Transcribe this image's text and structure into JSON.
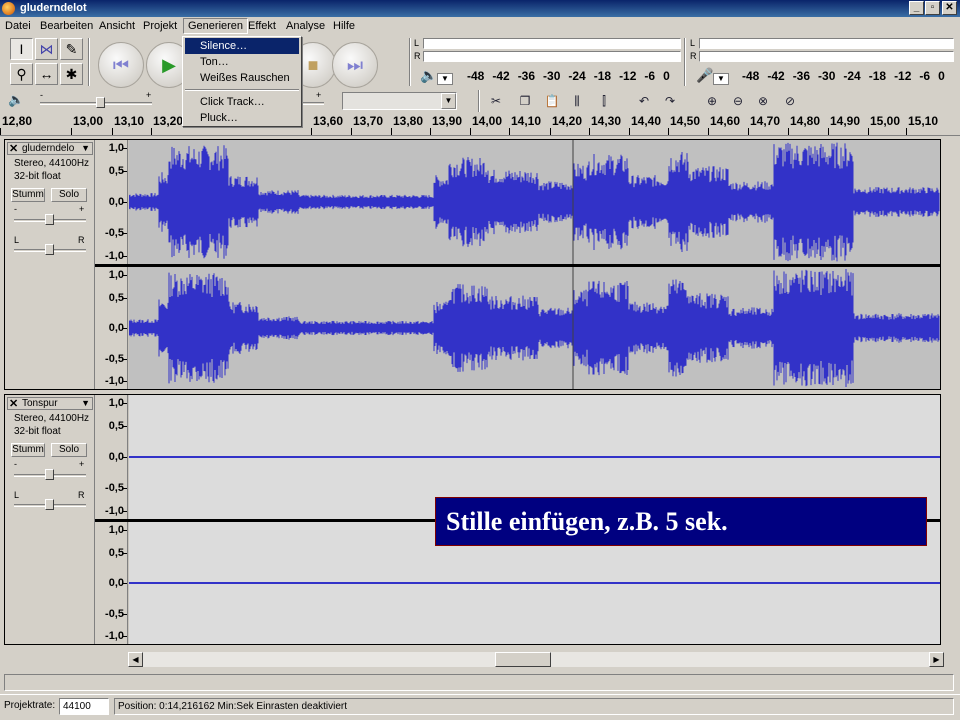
{
  "window": {
    "title": "gluderndelot",
    "buttons": [
      "_",
      "▫",
      "✕"
    ]
  },
  "menubar": {
    "items": [
      "Datei",
      "Bearbeiten",
      "Ansicht",
      "Projekt",
      "Generieren",
      "Effekt",
      "Analyse",
      "Hilfe"
    ],
    "open_menu": "Generieren"
  },
  "generate_menu": {
    "items": [
      "Silence…",
      "Ton…",
      "Weißes Rauschen",
      "Click Track…",
      "Pluck…"
    ],
    "highlighted": "Silence…"
  },
  "meters": {
    "output_L": "L",
    "output_R": "R",
    "input_L": "L",
    "input_R": "R",
    "db_ticks_left": [
      "-48",
      "-42",
      "-36",
      "-30",
      "-24",
      "-18",
      "-12",
      "-6",
      "0"
    ],
    "db_ticks_right": [
      "-48",
      "-42",
      "-36",
      "-30",
      "-24",
      "-18",
      "-12",
      "-6",
      "0"
    ]
  },
  "mixer": {
    "minus": "-",
    "plus": "+"
  },
  "ruler": {
    "labels": [
      "12,80",
      "13,00",
      "13,10",
      "13,20",
      "13,60",
      "13,70",
      "13,80",
      "13,90",
      "14,00",
      "14,10",
      "14,20",
      "14,30",
      "14,40",
      "14,50",
      "14,60",
      "14,70",
      "14,80",
      "14,90",
      "15,00",
      "15,10"
    ]
  },
  "tracks": [
    {
      "name": "gluderndelo",
      "info1": "Stereo, 44100Hz",
      "info2": "32-bit float",
      "mute": "Stumm",
      "solo": "Solo",
      "gain_minus": "-",
      "gain_plus": "+",
      "pan_left": "L",
      "pan_right": "R",
      "scale": [
        "1,0",
        "0,5",
        "0,0",
        "-0,5",
        "-1,0"
      ],
      "has_audio": true
    },
    {
      "name": "Tonspur",
      "info1": "Stereo, 44100Hz",
      "info2": "32-bit float",
      "mute": "Stumm",
      "solo": "Solo",
      "gain_minus": "-",
      "gain_plus": "+",
      "pan_left": "L",
      "pan_right": "R",
      "scale": [
        "1,0",
        "0,5",
        "0,0",
        "-0,5",
        "-1,0"
      ],
      "has_audio": false
    }
  ],
  "statusbar": {
    "rate_label": "Projektrate:",
    "rate_value": "44100",
    "position_text": "Position: 0:14,216162 Min:Sek  Einrasten deaktiviert"
  },
  "callout": {
    "text": "Stille einfügen, z.B. 5 sek."
  },
  "colors": {
    "waveform": "#3232c8",
    "wave_bg": "#c0c0c0",
    "highlight": "#0a246a",
    "callout_bg": "#000080"
  }
}
